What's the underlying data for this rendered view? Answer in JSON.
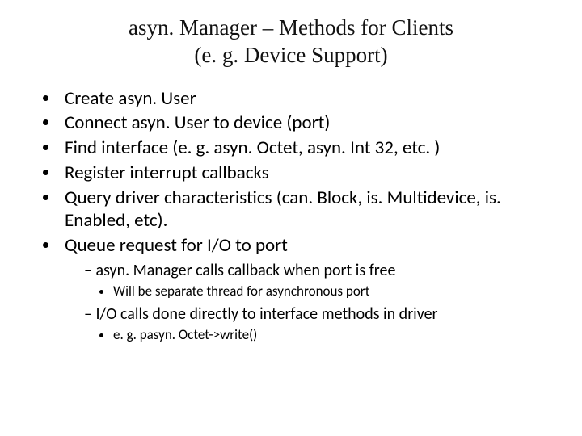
{
  "title": {
    "line1": "asyn. Manager – Methods for Clients",
    "line2": "(e. g. Device Support)"
  },
  "bullets": {
    "b1": "Create asyn. User",
    "b2": "Connect asyn. User to device (port)",
    "b3": "Find interface (e. g. asyn. Octet, asyn. Int 32, etc. )",
    "b4": "Register interrupt callbacks",
    "b5": "Query driver characteristics (can. Block, is. Multidevice, is. Enabled, etc).",
    "b6": "Queue request for I/O to port",
    "b6_sub1": "asyn. Manager calls callback when port is free",
    "b6_sub1_a": "Will be separate thread for asynchronous port",
    "b6_sub2": "I/O calls done directly to interface methods in driver",
    "b6_sub2_a": "e. g. pasyn. Octet->write()"
  }
}
